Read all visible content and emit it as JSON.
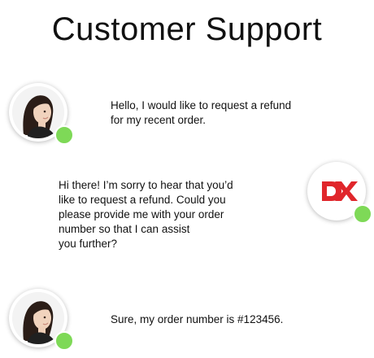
{
  "header": {
    "title": "Customer Support"
  },
  "colors": {
    "online_status": "#7ed957",
    "brand_red": "#e0262b"
  },
  "messages": [
    {
      "sender": "customer",
      "avatar_icon": "customer-avatar-woman",
      "text": "Hello, I would like to request a refund\nfor my recent order."
    },
    {
      "sender": "support",
      "avatar_icon": "support-logo",
      "text": "Hi there! I’m sorry to hear that you’d\nlike to request a refund. Could you\nplease provide me with your order\nnumber so that I can assist\nyou further?"
    },
    {
      "sender": "customer",
      "avatar_icon": "customer-avatar-woman",
      "text": "Sure, my order number is #123456."
    }
  ]
}
